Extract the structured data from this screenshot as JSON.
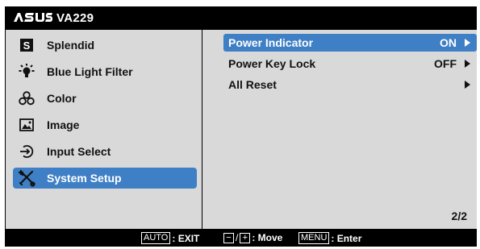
{
  "header": {
    "brand": "ASUS",
    "model": "VA229"
  },
  "left_menu": {
    "items": [
      {
        "label": "Splendid",
        "icon": "splendid-icon"
      },
      {
        "label": "Blue Light Filter",
        "icon": "blue-light-icon"
      },
      {
        "label": "Color",
        "icon": "color-icon"
      },
      {
        "label": "Image",
        "icon": "image-icon"
      },
      {
        "label": "Input Select",
        "icon": "input-select-icon"
      },
      {
        "label": "System Setup",
        "icon": "system-setup-icon"
      }
    ],
    "selected": "System Setup"
  },
  "right_menu": {
    "items": [
      {
        "label": "Power Indicator",
        "value": "ON"
      },
      {
        "label": "Power Key Lock",
        "value": "OFF"
      },
      {
        "label": "All Reset",
        "value": ""
      }
    ],
    "selected": "Power Indicator",
    "page": "2/2"
  },
  "footer": {
    "auto_key": "AUTO",
    "auto_desc": ": EXIT",
    "minus_key": "−",
    "plus_key": "+",
    "move_desc": ": Move",
    "menu_key": "MENU",
    "menu_desc": ": Enter"
  },
  "colors": {
    "highlight": "#3f7fc5",
    "panel": "#d9d9d9",
    "frame": "#000000"
  }
}
